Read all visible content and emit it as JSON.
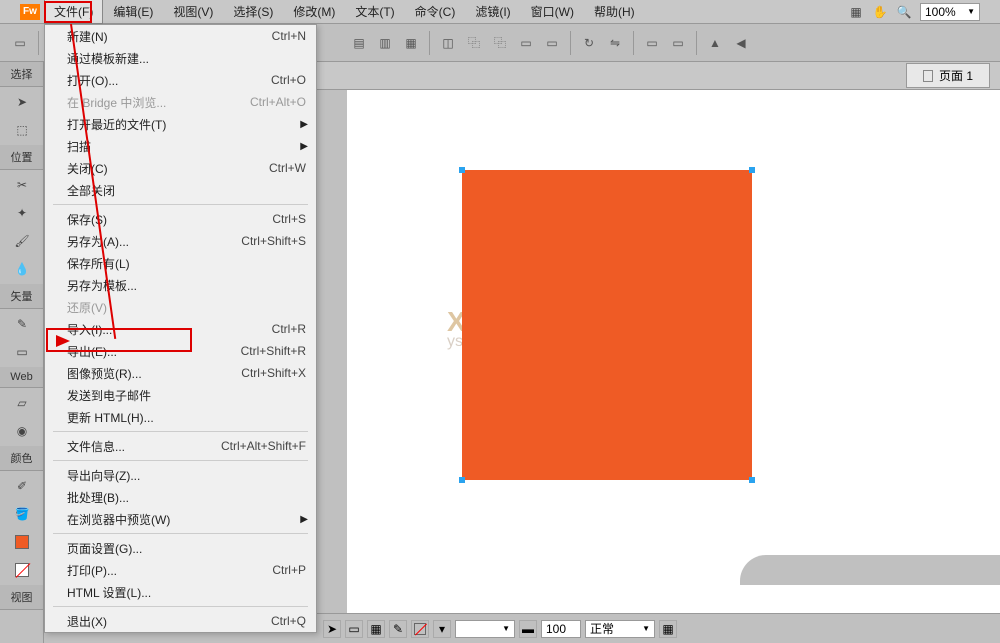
{
  "menubar": {
    "items": [
      "文件(F)",
      "编辑(E)",
      "视图(V)",
      "选择(S)",
      "修改(M)",
      "文本(T)",
      "命令(C)",
      "滤镜(I)",
      "窗口(W)",
      "帮助(H)"
    ],
    "zoom": "100%"
  },
  "dropdown": {
    "items": [
      {
        "label": "新建(N)",
        "sc": "Ctrl+N"
      },
      {
        "label": "通过模板新建...",
        "sc": ""
      },
      {
        "label": "打开(O)...",
        "sc": "Ctrl+O"
      },
      {
        "label": "在 Bridge 中浏览...",
        "sc": "Ctrl+Alt+O",
        "disabled": true
      },
      {
        "label": "打开最近的文件(T)",
        "sc": "",
        "arrow": true
      },
      {
        "label": "扫描",
        "sc": "",
        "arrow": true
      },
      {
        "label": "关闭(C)",
        "sc": "Ctrl+W"
      },
      {
        "label": "全部关闭",
        "sc": ""
      },
      {
        "sep": true
      },
      {
        "label": "保存(S)",
        "sc": "Ctrl+S"
      },
      {
        "label": "另存为(A)...",
        "sc": "Ctrl+Shift+S"
      },
      {
        "label": "保存所有(L)",
        "sc": ""
      },
      {
        "label": "另存为模板...",
        "sc": ""
      },
      {
        "label": "还原(V)",
        "sc": "",
        "disabled": true
      },
      {
        "label": "导入(I)...",
        "sc": "Ctrl+R"
      },
      {
        "label": "导出(E)...",
        "sc": "Ctrl+Shift+R"
      },
      {
        "label": "图像预览(R)...",
        "sc": "Ctrl+Shift+X"
      },
      {
        "label": "发送到电子邮件",
        "sc": ""
      },
      {
        "label": "更新 HTML(H)...",
        "sc": ""
      },
      {
        "sep": true
      },
      {
        "label": "文件信息...",
        "sc": "Ctrl+Alt+Shift+F"
      },
      {
        "sep": true
      },
      {
        "label": "导出向导(Z)...",
        "sc": ""
      },
      {
        "label": "批处理(B)...",
        "sc": ""
      },
      {
        "label": "在浏览器中预览(W)",
        "sc": "",
        "arrow": true
      },
      {
        "sep": true
      },
      {
        "label": "页面设置(G)...",
        "sc": ""
      },
      {
        "label": "打印(P)...",
        "sc": "Ctrl+P"
      },
      {
        "label": "HTML 设置(L)...",
        "sc": ""
      },
      {
        "sep": true
      },
      {
        "label": "退出(X)",
        "sc": "Ctrl+Q"
      }
    ]
  },
  "left": {
    "labels": [
      "选择",
      "位置",
      "矢量",
      "Web",
      "颜色",
      "视图"
    ]
  },
  "tab": {
    "label": "页面 1"
  },
  "watermark": {
    "line1": "X I 网",
    "line2": "ystem.com"
  },
  "status": {
    "size": "100",
    "mode": "正常",
    "empty": ""
  }
}
